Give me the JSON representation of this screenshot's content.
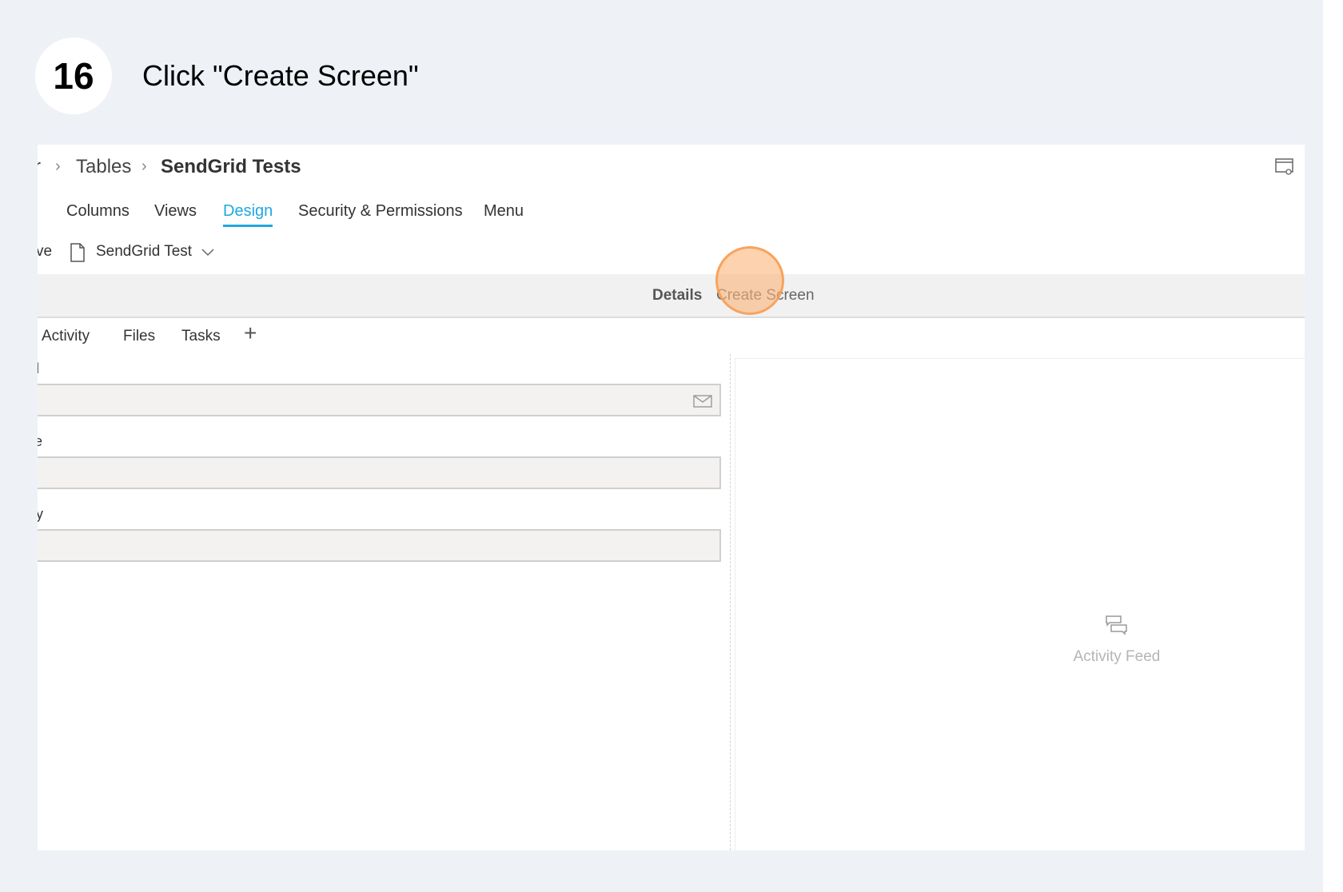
{
  "step": {
    "number": "16",
    "instruction": "Click \"Create Screen\""
  },
  "breadcrumb": {
    "partial": "r",
    "items": [
      "Tables",
      "SendGrid Tests"
    ]
  },
  "tabs": {
    "partial": ":",
    "items": [
      "Columns",
      "Views",
      "Design",
      "Security & Permissions",
      "Menu"
    ],
    "active": "Design"
  },
  "toolbar": {
    "partial": "ve",
    "screen_name": "SendGrid Test"
  },
  "bar": {
    "details": "Details",
    "create_screen": "Create Screen"
  },
  "subtabs": [
    "Activity",
    "Files",
    "Tasks"
  ],
  "form": {
    "labels": [
      "l",
      "e",
      "y"
    ]
  },
  "activity_feed": {
    "label": "Activity Feed"
  },
  "colors": {
    "accent": "#1fa8e0",
    "click_highlight": "#f79b50",
    "background": "#eef2f7"
  }
}
